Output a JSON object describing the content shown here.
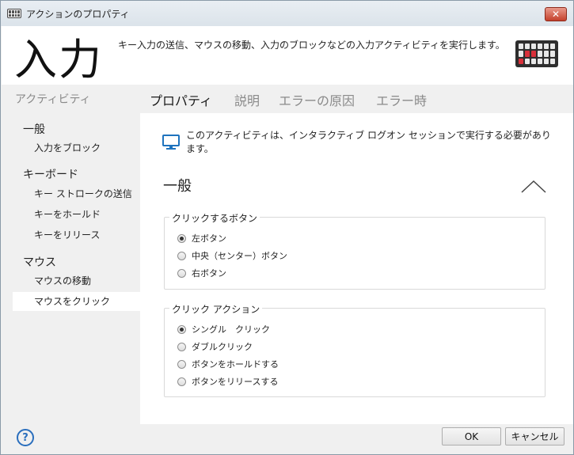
{
  "window": {
    "title": "アクションのプロパティ",
    "close_glyph": "✕"
  },
  "header": {
    "title": "入力",
    "description": "キー入力の送信、マウスの移動、入力のブロックなどの入力アクティビティを実行します。"
  },
  "sidebar": {
    "caption": "アクティビティ",
    "groups": [
      {
        "label": "一般",
        "items": [
          "入力をブロック"
        ]
      },
      {
        "label": "キーボード",
        "items": [
          "キー ストロークの送信",
          "キーをホールド",
          "キーをリリース"
        ]
      },
      {
        "label": "マウス",
        "items": [
          "マウスの移動",
          "マウスをクリック"
        ]
      }
    ],
    "active_item": "マウスをクリック"
  },
  "tabs": [
    {
      "label": "プロパティ",
      "active": true
    },
    {
      "label": "説明",
      "active": false
    },
    {
      "label": "エラーの原因",
      "active": false
    },
    {
      "label": "エラー時",
      "active": false
    }
  ],
  "content": {
    "notice": "このアクティビティは、インタラクティブ ログオン セッションで実行する必要があります。",
    "section_title": "一般",
    "button_group": {
      "legend": "クリックするボタン",
      "options": [
        "左ボタン",
        "中央（センター）ボタン",
        "右ボタン"
      ],
      "selected_index": 0
    },
    "action_group": {
      "legend": "クリック アクション",
      "options": [
        "シングル　クリック",
        "ダブルクリック",
        "ボタンをホールドする",
        "ボタンをリリースする"
      ],
      "selected_index": 0
    }
  },
  "footer": {
    "help_glyph": "?",
    "ok_label": "OK",
    "cancel_label": "キャンセル"
  },
  "colors": {
    "close_button": "#c4412c",
    "help_icon": "#2a6ebd",
    "keyboard_accent": "#d9303a",
    "monitor_icon": "#1e73be"
  }
}
